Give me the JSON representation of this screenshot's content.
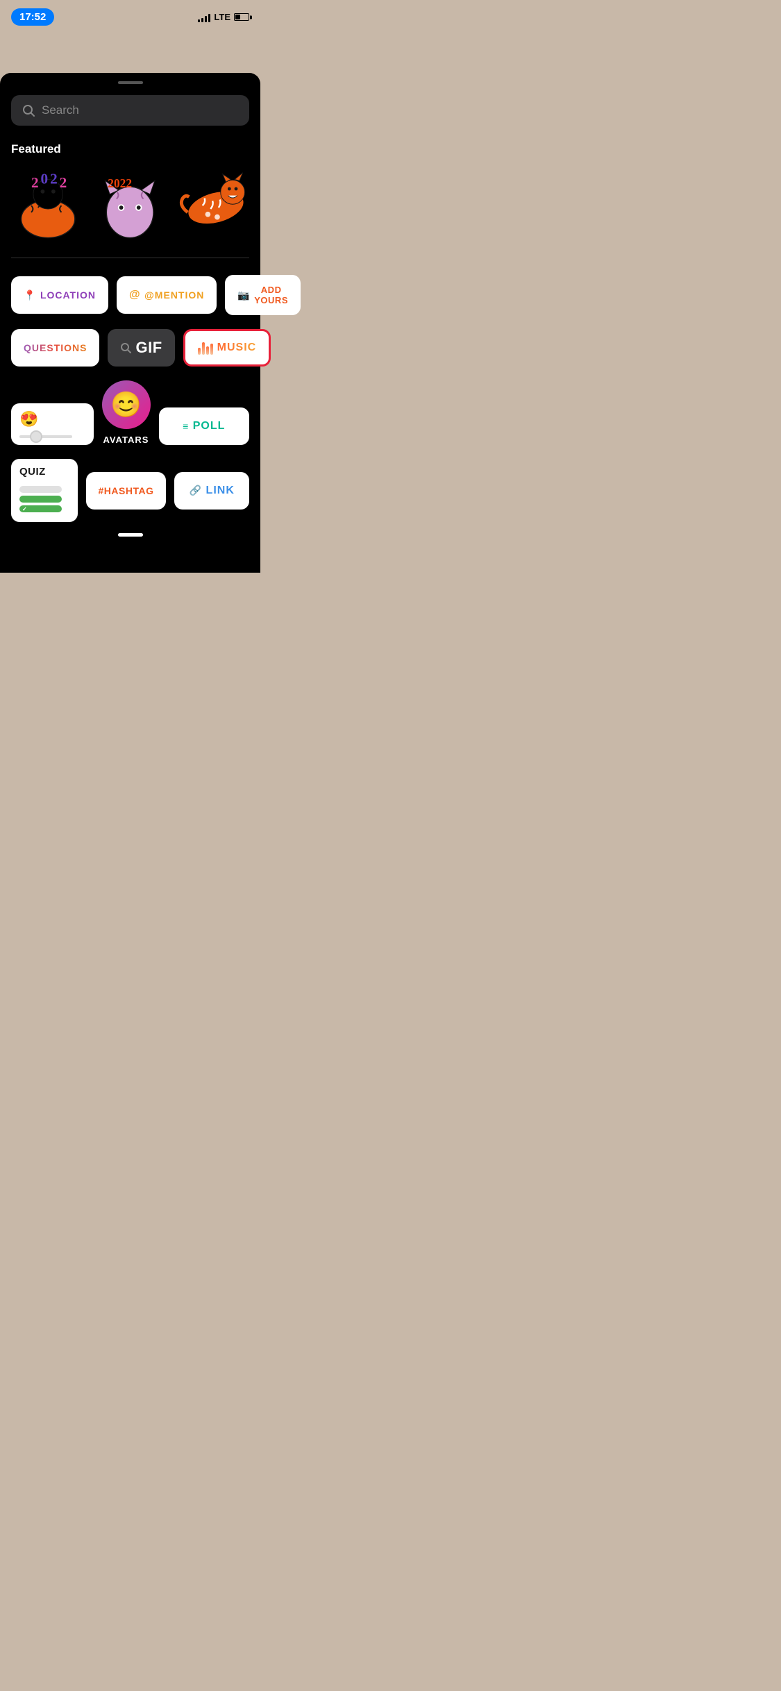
{
  "statusBar": {
    "time": "17:52",
    "carrier": "LTE"
  },
  "searchBar": {
    "placeholder": "Search"
  },
  "featured": {
    "title": "Featured"
  },
  "stickers": {
    "location": "LOCATION",
    "mention": "@MENTION",
    "addYours": "ADD YOURS",
    "questions": "QUESTIONS",
    "gif": "GIF",
    "music": "MUSIC",
    "avatars": "AVATARS",
    "poll": "POLL",
    "quiz": "QUIZ",
    "hashtag": "#HASHTAG",
    "link": "LINK",
    "emojiSlider": "😍"
  }
}
